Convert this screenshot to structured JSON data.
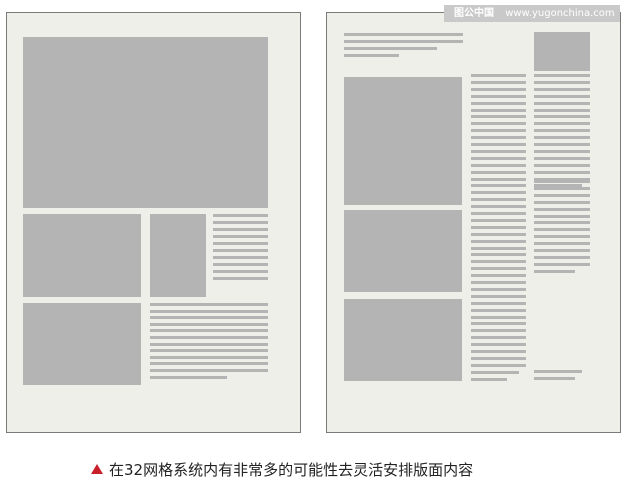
{
  "watermark": {
    "logo": "图公中国",
    "url": "www.yugonchina.com"
  },
  "caption": {
    "text": "在32网格系统内有非常多的可能性去灵活安排版面内容"
  },
  "colors": {
    "page": "#efefe9",
    "placeholder": "#b4b4b4",
    "border": "#7a7a7a",
    "triangle": "#c8202a"
  },
  "icons": {
    "caption_marker": "red-triangle-up"
  }
}
